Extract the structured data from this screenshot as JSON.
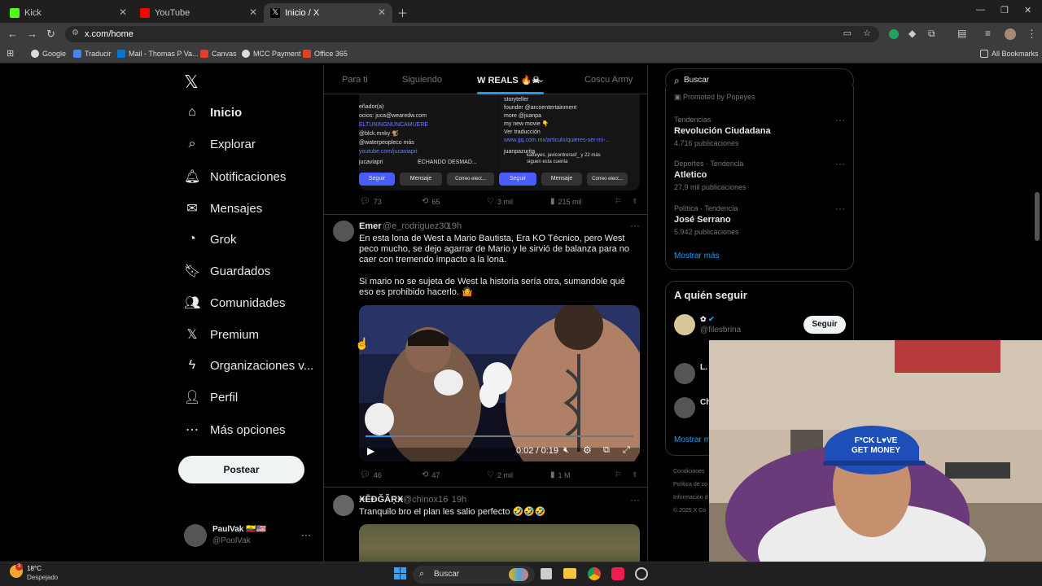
{
  "browser": {
    "tabs": [
      {
        "title": "Kick",
        "color": "#53fc18"
      },
      {
        "title": "YouTube",
        "color": "#ff0000"
      },
      {
        "title": "Inicio / X",
        "color": "#ffffff"
      }
    ],
    "url": "x.com/home",
    "bookmarks": [
      "Google",
      "Traducir",
      "Mail - Thomas P Va...",
      "Canvas",
      "MCC Payment",
      "Office 365"
    ],
    "all_bookmarks": "All Bookmarks"
  },
  "nav": {
    "items": [
      {
        "label": "Inicio",
        "icon": "⌂"
      },
      {
        "label": "Explorar",
        "icon": "⌕"
      },
      {
        "label": "Notificaciones",
        "icon": "🔔︎"
      },
      {
        "label": "Mensajes",
        "icon": "✉"
      },
      {
        "label": "Grok",
        "icon": "◔"
      },
      {
        "label": "Guardados",
        "icon": "🔖︎"
      },
      {
        "label": "Comunidades",
        "icon": "👥︎"
      },
      {
        "label": "Premium",
        "icon": "𝕏"
      },
      {
        "label": "Organizaciones v...",
        "icon": "ϟ"
      },
      {
        "label": "Perfil",
        "icon": "👤︎"
      },
      {
        "label": "Más opciones",
        "icon": "⋯"
      }
    ],
    "post_button": "Postear",
    "account": {
      "name": "PaulVak 🇪🇨🇺🇸",
      "handle": "@PoolVak"
    }
  },
  "feed": {
    "tabs": [
      "Para ti",
      "Siguiendo",
      "W REALS 🔥☠",
      "Coscu Army"
    ],
    "quote_left": {
      "lines": [
        "eñador(a)",
        "ocios: juca@wearedw.com",
        "ELTUNINGNUNCAMUERE",
        "@blck.mnky 🐒",
        "@waterpeopleco   más",
        "youtube.com/jucaviapri"
      ],
      "user": "jucaviapri",
      "extra": "ECHANDO DESMAD...",
      "btn_follow": "Seguir",
      "btn_msg": "Mensaje",
      "btn_mail": "Correo elect..."
    },
    "quote_right": {
      "lines": [
        "storyteller",
        "founder @arcoentertainment",
        "more @juanpa",
        "my new movie 👇",
        "Ver traducción",
        "www.gq.com.mx/articulo/quieres-ser-mi-...",
        "juanpazurita"
      ],
      "followers": "katteyes, javicontrerasf_ y 22 más",
      "followers_sub": "siguen esta cuenta",
      "btn_follow": "Seguir",
      "btn_msg": "Mensaje",
      "btn_mail": "Correo elect..."
    },
    "post1_stats": {
      "replies": "73",
      "reposts": "65",
      "likes": "3 mil",
      "views": "215 mil"
    },
    "post2": {
      "name": "Emer",
      "handle": "@e_rodriguez30",
      "time": "· 19h",
      "text1": "En esta lona de West a Mario Bautista, Era KO Técnico, pero West peco mucho, se dejo agarrar de Mario y le sirvió de balanza para no caer con tremendo impacto a la lona.",
      "text2": "Si mario no se sujeta de West la historia sería otra, sumandole qué eso es prohibido hacerlo. 🤷",
      "video_time": "0:02 / 0:19",
      "video_progress": 0.1,
      "stats": {
        "replies": "46",
        "reposts": "47",
        "likes": "2 mil",
        "views": "1 M"
      }
    },
    "post3": {
      "name": "ӾĒĐĞÃŖӾ",
      "handle": "@chinox16",
      "time": "· 19h",
      "text": "Tranquilo bro el plan les salio perfecto 🤣🤣🤣"
    }
  },
  "right": {
    "search_placeholder": "Buscar",
    "promoted": "Promoted by Popeyes",
    "trends": [
      {
        "meta": "Tendencias",
        "name": "Revolución Ciudadana",
        "count": "4.716 publicaciones"
      },
      {
        "meta": "Deportes · Tendencia",
        "name": "Atletico",
        "count": "27,9 mil publicaciones"
      },
      {
        "meta": "Política · Tendencia",
        "name": "José Serrano",
        "count": "5.942 publicaciones"
      }
    ],
    "show_more": "Mostrar más",
    "who_to_follow": "A quién seguir",
    "follow_user": {
      "name": "✿",
      "handle": "@filesbrina"
    },
    "follow_btn": "Seguir",
    "follow2": "L.",
    "follow3": "Ch",
    "show_more2": "Mostrar m",
    "footer": [
      "Condiciones",
      "Política de co",
      "Información d",
      "© 2025 X Co"
    ]
  },
  "taskbar": {
    "weather_temp": "18°C",
    "weather_desc": "Despejado",
    "weather_badge": "3",
    "search": "Buscar"
  },
  "webcam": {
    "cap_text_1": "F*CK L♥VE",
    "cap_text_2": "GET MONEY"
  }
}
